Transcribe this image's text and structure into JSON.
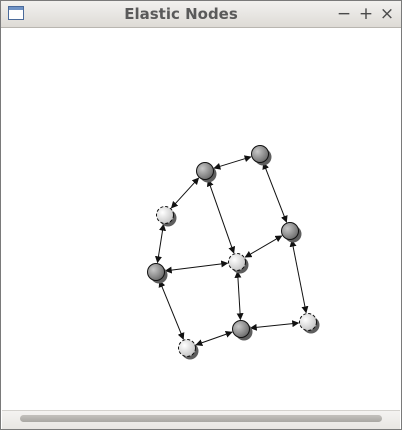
{
  "window": {
    "title": "Elastic Nodes",
    "minimize_glyph": "−",
    "maximize_glyph": "+",
    "close_glyph": "×"
  },
  "graph": {
    "nodes": [
      {
        "id": "n1",
        "style": "dark"
      },
      {
        "id": "n2",
        "style": "dark"
      },
      {
        "id": "n3",
        "style": "light"
      },
      {
        "id": "n4",
        "style": "dark"
      },
      {
        "id": "n5",
        "style": "light"
      },
      {
        "id": "n6",
        "style": "dark"
      },
      {
        "id": "n7",
        "style": "dark"
      },
      {
        "id": "n8",
        "style": "light"
      },
      {
        "id": "n9",
        "style": "light"
      }
    ],
    "edges": [
      [
        "n1",
        "n2"
      ],
      [
        "n1",
        "n3"
      ],
      [
        "n1",
        "n5"
      ],
      [
        "n2",
        "n6"
      ],
      [
        "n3",
        "n4"
      ],
      [
        "n4",
        "n5"
      ],
      [
        "n6",
        "n5"
      ],
      [
        "n4",
        "n9"
      ],
      [
        "n5",
        "n7"
      ],
      [
        "n6",
        "n8"
      ],
      [
        "n9",
        "n7"
      ],
      [
        "n7",
        "n8"
      ]
    ]
  },
  "colors": {
    "node_dark_fill": "#8e8e8e",
    "node_light_fill": "#eeeeee",
    "edge_color": "#111111"
  }
}
